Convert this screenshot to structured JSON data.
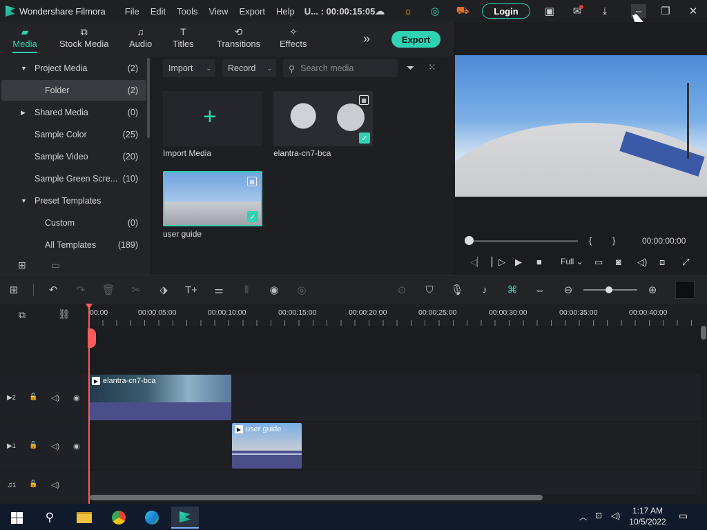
{
  "titlebar": {
    "app_name": "Wondershare Filmora",
    "menu": [
      "File",
      "Edit",
      "Tools",
      "View",
      "Export",
      "Help"
    ],
    "project_time": "U... : 00:00:15:05",
    "login_label": "Login"
  },
  "media_tabs": [
    {
      "label": "Media",
      "icon": "folder-icon",
      "active": true
    },
    {
      "label": "Stock Media",
      "icon": "image-icon"
    },
    {
      "label": "Audio",
      "icon": "music-note-icon"
    },
    {
      "label": "Titles",
      "icon": "text-icon"
    },
    {
      "label": "Transitions",
      "icon": "transitions-icon"
    },
    {
      "label": "Effects",
      "icon": "effects-icon"
    }
  ],
  "export_label": "Export",
  "tree": [
    {
      "label": "Project Media",
      "count": "(2)",
      "expandable": true,
      "expanded": true
    },
    {
      "label": "Folder",
      "count": "(2)",
      "selected": true
    },
    {
      "label": "Shared Media",
      "count": "(0)",
      "expandable": true
    },
    {
      "label": "Sample Color",
      "count": "(25)"
    },
    {
      "label": "Sample Video",
      "count": "(20)"
    },
    {
      "label": "Sample Green Scre...",
      "count": "(10)"
    },
    {
      "label": "Preset Templates",
      "count": "",
      "expandable": true,
      "expanded": true
    },
    {
      "label": "Custom",
      "count": "(0)"
    },
    {
      "label": "All Templates",
      "count": "(189)"
    }
  ],
  "media_toolbar": {
    "import_label": "Import",
    "record_label": "Record",
    "search_placeholder": "Search media"
  },
  "media_items": [
    {
      "label": "Import Media"
    },
    {
      "label": "elantra-cn7-bca"
    },
    {
      "label": "user guide"
    }
  ],
  "preview": {
    "bracket_in": "{",
    "bracket_out": "}",
    "timecode": "00:00:00:00",
    "quality": "Full"
  },
  "ruler_ticks": [
    "00:00",
    "00:00:05:00",
    "00:00:10:00",
    "00:00:15:00",
    "00:00:20:00",
    "00:00:25:00",
    "00:00:30:00",
    "00:00:35:00",
    "00:00:40:00"
  ],
  "tracks": {
    "video2_label": "2",
    "video1_label": "1",
    "audio1_label": "1",
    "clip_a": "elantra-cn7-bca",
    "clip_b": "user guide"
  },
  "taskbar": {
    "time": "1:17 AM",
    "date": "10/5/2022"
  },
  "colors": {
    "accent": "#2fd3b1",
    "playhead": "#ff5a5a",
    "clip": "#4a4f8a"
  }
}
